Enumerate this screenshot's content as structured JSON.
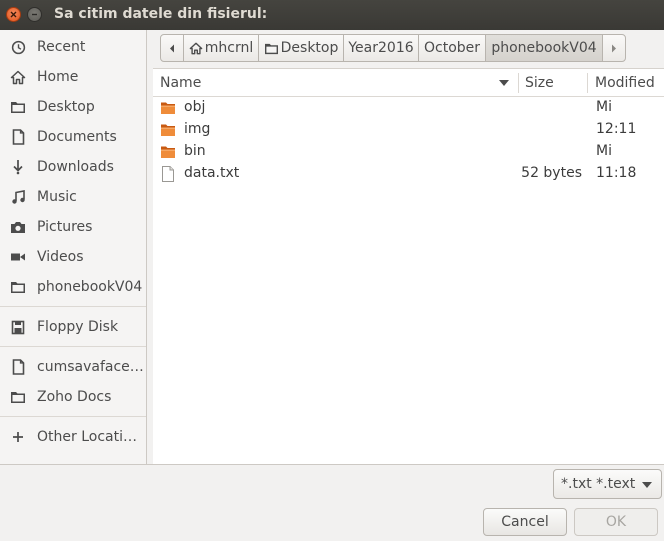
{
  "window": {
    "title": "Sa citim datele din fisierul:"
  },
  "sidebar": {
    "items": [
      {
        "label": "Recent",
        "icon": "clock-icon"
      },
      {
        "label": "Home",
        "icon": "home-icon"
      },
      {
        "label": "Desktop",
        "icon": "folder-icon"
      },
      {
        "label": "Documents",
        "icon": "document-icon"
      },
      {
        "label": "Downloads",
        "icon": "download-icon"
      },
      {
        "label": "Music",
        "icon": "music-icon"
      },
      {
        "label": "Pictures",
        "icon": "camera-icon"
      },
      {
        "label": "Videos",
        "icon": "video-icon"
      },
      {
        "label": "phonebookV04",
        "icon": "folder-icon"
      },
      {
        "label": "Floppy Disk",
        "icon": "floppy-icon"
      },
      {
        "label": "cumsavafacem...",
        "icon": "document-icon"
      },
      {
        "label": "Zoho Docs",
        "icon": "folder-icon"
      },
      {
        "label": "Other Locations",
        "icon": "plus-icon"
      }
    ]
  },
  "pathbar": {
    "segments": [
      "mhcrnl",
      "Desktop",
      "Year2016",
      "October",
      "phonebookV04"
    ],
    "active_index": 4
  },
  "filelist": {
    "columns": {
      "name": "Name",
      "size": "Size",
      "modified": "Modified"
    },
    "rows": [
      {
        "name": "obj",
        "type": "folder",
        "size": "",
        "modified": "Mi"
      },
      {
        "name": "img",
        "type": "folder",
        "size": "",
        "modified": "12:11"
      },
      {
        "name": "bin",
        "type": "folder",
        "size": "",
        "modified": "Mi"
      },
      {
        "name": "data.txt",
        "type": "file",
        "size": "52 bytes",
        "modified": "11:18"
      }
    ]
  },
  "filter": {
    "selected": "*.txt *.text"
  },
  "buttons": {
    "cancel": "Cancel",
    "ok": "OK"
  },
  "colors": {
    "folder": "#e8781e",
    "close_button": "#e1541c",
    "titlebar": "#3e3d39"
  }
}
